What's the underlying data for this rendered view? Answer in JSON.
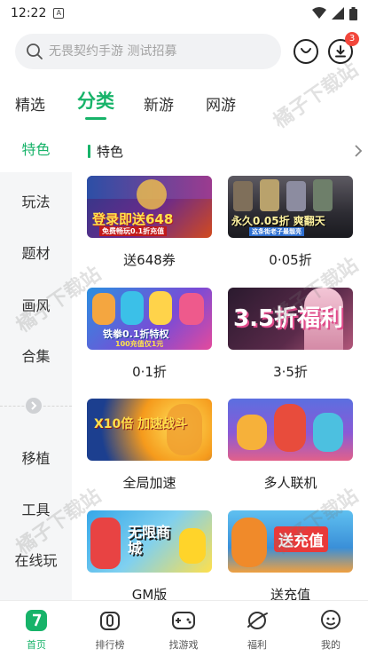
{
  "status_bar": {
    "time": "12:22",
    "a_icon": "A"
  },
  "search": {
    "placeholder": "无畏契约手游 测试招募",
    "download_badge": "3"
  },
  "top_tabs": [
    {
      "label": "精选",
      "active": false
    },
    {
      "label": "分类",
      "active": true
    },
    {
      "label": "新游",
      "active": false
    },
    {
      "label": "网游",
      "active": false
    }
  ],
  "side_nav": [
    {
      "label": "特色",
      "active": true
    },
    {
      "label": "玩法",
      "active": false
    },
    {
      "label": "题材",
      "active": false
    },
    {
      "label": "画风",
      "active": false
    },
    {
      "label": "合集",
      "active": false
    },
    {
      "label": "移植",
      "active": false
    },
    {
      "label": "工具",
      "active": false
    },
    {
      "label": "在线玩",
      "active": false
    }
  ],
  "section": {
    "title": "特色"
  },
  "cards": [
    {
      "label": "送648券",
      "banner": "登录即送648",
      "banner_sub": "免费畅玩0.1折充值"
    },
    {
      "label": "0·05折",
      "banner": "永久0.05折 爽翻天",
      "banner_sub": "这条街老子最靓亮"
    },
    {
      "label": "0·1折",
      "banner": "铁拳0.1折特权",
      "banner_sub": "100充值仅1元"
    },
    {
      "label": "3·5折",
      "banner": "3.5折福利",
      "banner_sub": ""
    },
    {
      "label": "全局加速",
      "banner": "X10倍 加速战斗",
      "banner_sub": ""
    },
    {
      "label": "多人联机",
      "banner": "",
      "banner_sub": ""
    },
    {
      "label": "GM版",
      "banner": "无限商城",
      "banner_sub": ""
    },
    {
      "label": "送充值",
      "banner": "送充值",
      "banner_sub": ""
    }
  ],
  "bottom_nav": [
    {
      "label": "首页",
      "icon": "home-icon",
      "active": true
    },
    {
      "label": "排行榜",
      "icon": "ranking-icon",
      "active": false
    },
    {
      "label": "找游戏",
      "icon": "gamepad-icon",
      "active": false
    },
    {
      "label": "福利",
      "icon": "gift-planet-icon",
      "active": false
    },
    {
      "label": "我的",
      "icon": "profile-icon",
      "active": false
    }
  ],
  "watermark": "橘子下载站",
  "colors": {
    "accent": "#17b369",
    "badge": "#f2463b",
    "side_bg": "#f5f6f7"
  }
}
